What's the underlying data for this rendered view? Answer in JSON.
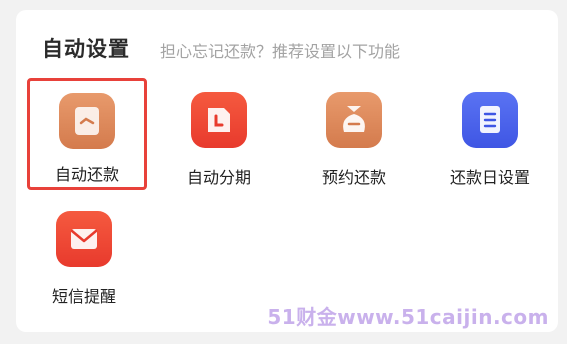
{
  "section": {
    "title": "自动设置",
    "subtitle": "担心忘记还款？推荐设置以下功能"
  },
  "items": [
    {
      "label": "自动还款",
      "icon": "document-icon",
      "color": "#de8a5c",
      "selected": true
    },
    {
      "label": "自动分期",
      "icon": "calendar-icon",
      "color": "#f04a35",
      "selected": false
    },
    {
      "label": "预约还款",
      "icon": "money-bag-icon",
      "color": "#de8a5c",
      "selected": false
    },
    {
      "label": "还款日设置",
      "icon": "book-icon",
      "color": "#4a63ee",
      "selected": false
    },
    {
      "label": "短信提醒",
      "icon": "mail-icon",
      "color": "#f04a35",
      "selected": false
    }
  ],
  "colors": {
    "selection_border": "#e8413a",
    "orange_icon": "#de8a5c",
    "red_icon": "#f04a35",
    "blue_icon": "#4a63ee"
  },
  "watermark": "51财金www.51caijin.com"
}
